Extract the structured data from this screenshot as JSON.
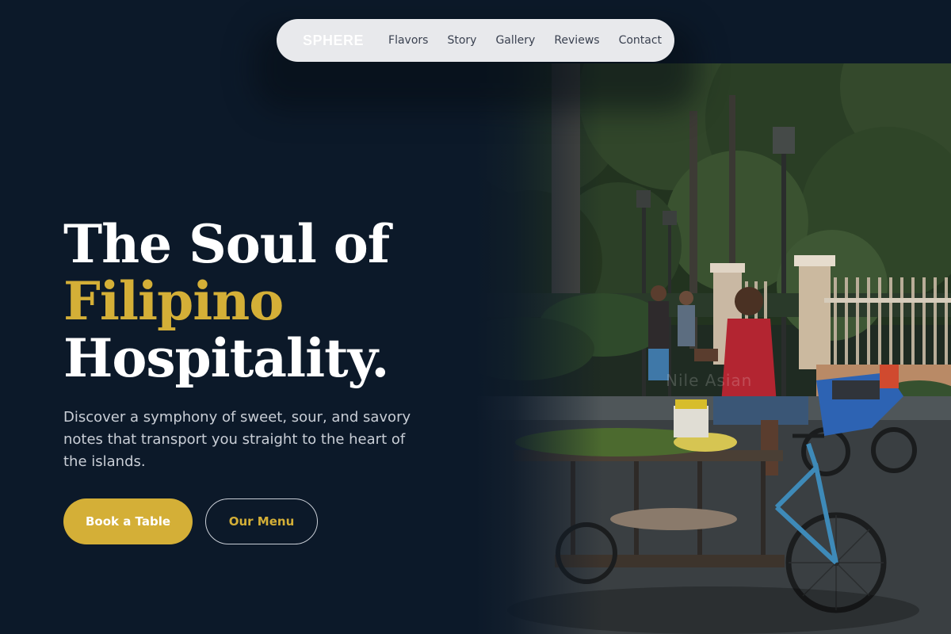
{
  "nav": {
    "brand": "SPHERE",
    "links": [
      "Flavors",
      "Story",
      "Gallery",
      "Reviews",
      "Contact"
    ]
  },
  "hero": {
    "headline_line1": "The Soul of",
    "headline_accent": "Filipino",
    "headline_line3": "Hospitality.",
    "description": "Discover a symphony of sweet, sour, and savory notes that transport you straight to the heart of the islands.",
    "primary_button": "Book a Table",
    "secondary_button": "Our Menu",
    "photo_watermark": "Nile Asian"
  },
  "colors": {
    "background": "#0c1929",
    "accent_gold": "#d4af37",
    "nav_pill": "#e8e9ec",
    "body_text": "#c9ced6"
  }
}
